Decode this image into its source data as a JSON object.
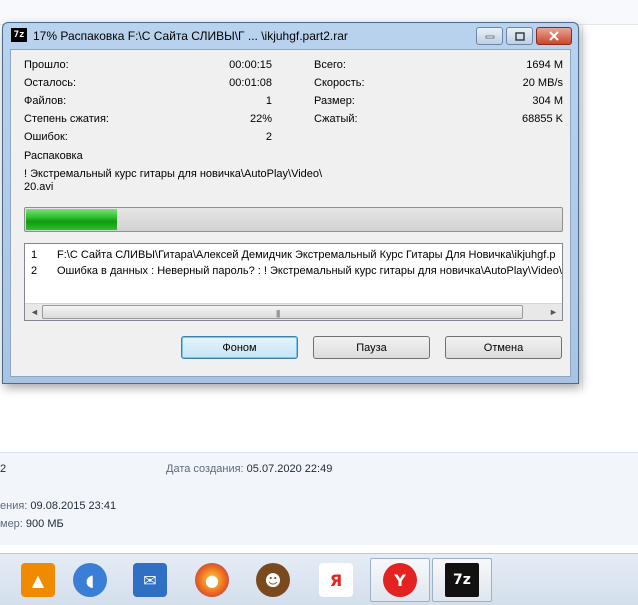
{
  "window": {
    "title": "17% Распаковка F:\\С Сайта СЛИВЫ\\Г ... \\ikjuhgf.part2.rar",
    "app_icon_text": "7z"
  },
  "stats": {
    "elapsed_label": "Прошло:",
    "elapsed_value": "00:00:15",
    "remaining_label": "Осталось:",
    "remaining_value": "00:01:08",
    "files_label": "Файлов:",
    "files_value": "1",
    "ratio_label": "Степень сжатия:",
    "ratio_value": "22%",
    "errors_label": "Ошибок:",
    "errors_value": "2",
    "total_label": "Всего:",
    "total_value": "1694 M",
    "speed_label": "Скорость:",
    "speed_value": "20 MB/s",
    "size_label": "Размер:",
    "size_value": "304 M",
    "packed_label": "Сжатый:",
    "packed_value": "68855 K"
  },
  "operation": "Распаковка",
  "current_file_line1": "! Экстремальный курс гитары для новичка\\AutoPlay\\Video\\",
  "current_file_line2": "20.avi",
  "progress": {
    "fraction": 0.17,
    "color": "#22b522"
  },
  "log": [
    {
      "num": "1",
      "text": "F:\\С Сайта СЛИВЫ\\Гитара\\Алексей Демидчик Экстремальный Курс Гитары Для Новичка\\ikjuhgf.p"
    },
    {
      "num": "2",
      "text": "Ошибка в данных : Неверный пароль? : ! Экстремальный курс гитары для новичка\\AutoPlay\\Video\\"
    }
  ],
  "scrollbar": {
    "left_arrow": "◄",
    "right_arrow": "►",
    "grip": "|||"
  },
  "buttons": {
    "background": "Фоном",
    "pause": "Пауза",
    "cancel": "Отмена"
  },
  "details": {
    "left_top": "2",
    "created_label": "Дата создания:",
    "created_value": "05.07.2020 22:49",
    "modified_label": "ения:",
    "modified_value": "09.08.2015 23:41",
    "size_label": "мер:",
    "size_value": "900 МБ"
  },
  "taskbar": [
    {
      "name": "vlc-icon",
      "glyph": "▲",
      "color": "#f08a00"
    },
    {
      "name": "volume-icon",
      "glyph": "◖",
      "color": "#3a7fd6"
    },
    {
      "name": "mail-icon",
      "glyph": "✉",
      "color": "#2f6fc4"
    },
    {
      "name": "firefox-icon",
      "glyph": "●",
      "color": "#e8601c"
    },
    {
      "name": "monkey-icon",
      "glyph": "☻",
      "color": "#7a4a1e"
    },
    {
      "name": "yandex-icon",
      "glyph": "Я",
      "color": "#e32222"
    },
    {
      "name": "yandex-browser-icon",
      "glyph": "Y",
      "color": "#e32222"
    },
    {
      "name": "7zip-icon",
      "glyph": "7z",
      "color": "#111111"
    }
  ]
}
